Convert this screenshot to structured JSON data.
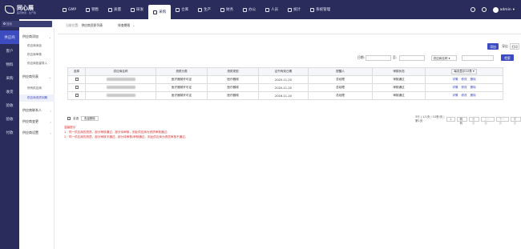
{
  "app": {
    "name": "同心展",
    "subtitle": "医药物流 · 生产版"
  },
  "topnav": [
    {
      "label": "GMP"
    },
    {
      "label": "销售"
    },
    {
      "label": "质量"
    },
    {
      "label": "研发"
    },
    {
      "label": "采购"
    },
    {
      "label": "仓库"
    },
    {
      "label": "生产"
    },
    {
      "label": "财务"
    },
    {
      "label": "办公"
    },
    {
      "label": "人员"
    },
    {
      "label": "统计"
    },
    {
      "label": "系统管理"
    }
  ],
  "user": {
    "name": "admin"
  },
  "search": {
    "placeholder": "搜索"
  },
  "sidebar": [
    {
      "label": "供应商"
    },
    {
      "label": "客户"
    },
    {
      "label": "物料"
    },
    {
      "label": "采购"
    },
    {
      "label": "收货"
    },
    {
      "label": "验收"
    },
    {
      "label": "验收"
    },
    {
      "label": "付款"
    }
  ],
  "subnav": {
    "group1": "供应商添加",
    "items1": [
      "供应商添加",
      "供应商审核",
      "供应商批量导入"
    ],
    "group2": "供应商列表",
    "items2": [
      "所有供应商",
      "供应商资质到期"
    ],
    "group3": "供应商联系人",
    "group4": "供应商变更",
    "group5": "供应商设置"
  },
  "breadcrumb": {
    "prefix": "当前位置:",
    "current": "供应商资质列表",
    "tab": "排查期限"
  },
  "actions": {
    "add": "添加",
    "export": "导出",
    "print": "打印"
  },
  "filter": {
    "date_label": "日期:",
    "to_label": "至:",
    "select": "供应商名称",
    "search": "检索"
  },
  "table": {
    "headers": [
      "选择",
      "供应商名称",
      "资质分类",
      "资质类型",
      "证书有效日期",
      "提醒人",
      "审核状态",
      "每页显示10条"
    ],
    "rows": [
      {
        "category": "医疗器械许可证",
        "type": "医疗器械",
        "date": "2025-11-20",
        "remind": "总经理",
        "status": "审核通过"
      },
      {
        "category": "医疗器械许可证",
        "type": "医疗器械",
        "date": "2020-11-20",
        "remind": "总经理",
        "status": "审核通过"
      },
      {
        "category": "医疗器械许可证",
        "type": "医疗器械",
        "date": "2016-11-20",
        "remind": "总经理",
        "status": "审核通过"
      }
    ],
    "ops": [
      "详情",
      "修改",
      "删除"
    ]
  },
  "bulk": {
    "select_all": "全选",
    "batch_delete": "批量删除"
  },
  "pager": {
    "summary": "3行 | 1/1页 | 10条/页 | 第1页",
    "page_value": "1",
    "go": "跳转",
    "first": "首页",
    "prev": "上一页",
    "next": "下一页",
    "last": "尾页"
  },
  "tips": {
    "title": "温馨提示",
    "line1": "1、同一供应商的资质，部分审核通过，部分待审核，则此供应商为资质审核通过;",
    "line2": "2、同一供应商的资质，部分审核不通过，部分待审核/审核通过，则此供应商为资质审核不通过;"
  },
  "colors": {
    "topbar": "#2a2d5c",
    "accent": "#3c4cc0",
    "tip": "#e0302f"
  }
}
